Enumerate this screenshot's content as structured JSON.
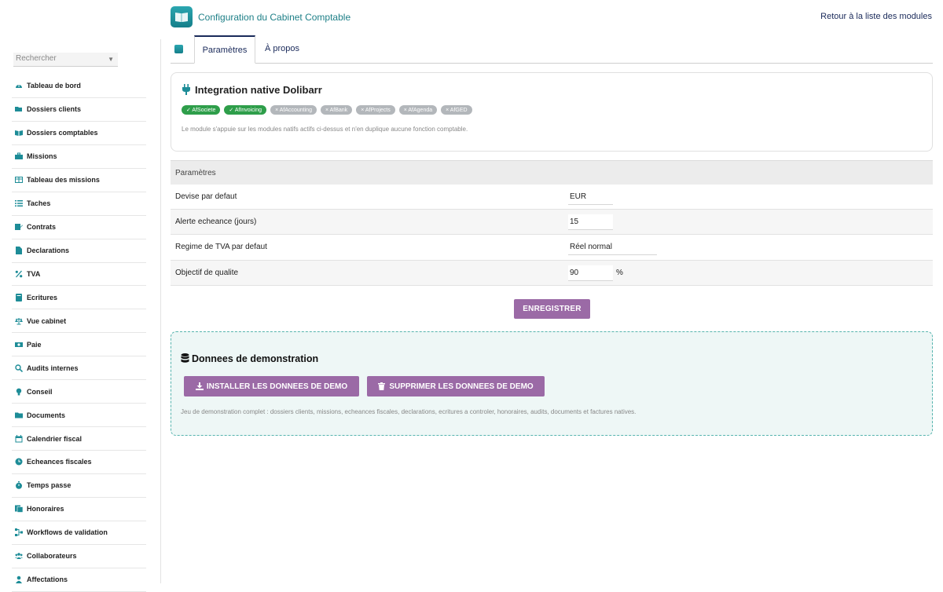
{
  "header": {
    "title": "Configuration du Cabinet Comptable",
    "back_link": "Retour à la liste des modules"
  },
  "sidebar": {
    "search_placeholder": "Rechercher",
    "items": [
      {
        "label": "Tableau de bord",
        "icon": "dashboard-icon"
      },
      {
        "label": "Dossiers clients",
        "icon": "folder-open-icon"
      },
      {
        "label": "Dossiers comptables",
        "icon": "book-icon"
      },
      {
        "label": "Missions",
        "icon": "briefcase-icon"
      },
      {
        "label": "Tableau des missions",
        "icon": "table-icon"
      },
      {
        "label": "Taches",
        "icon": "list-icon"
      },
      {
        "label": "Contrats",
        "icon": "contract-icon"
      },
      {
        "label": "Declarations",
        "icon": "file-icon"
      },
      {
        "label": "TVA",
        "icon": "percent-icon"
      },
      {
        "label": "Ecritures",
        "icon": "ledger-icon"
      },
      {
        "label": "Vue cabinet",
        "icon": "scale-icon"
      },
      {
        "label": "Paie",
        "icon": "money-icon"
      },
      {
        "label": "Audits internes",
        "icon": "search-icon"
      },
      {
        "label": "Conseil",
        "icon": "lightbulb-icon"
      },
      {
        "label": "Documents",
        "icon": "folder-icon"
      },
      {
        "label": "Calendrier fiscal",
        "icon": "calendar-icon"
      },
      {
        "label": "Echeances fiscales",
        "icon": "clock-icon"
      },
      {
        "label": "Temps passe",
        "icon": "stopwatch-icon"
      },
      {
        "label": "Honoraires",
        "icon": "invoice-icon"
      },
      {
        "label": "Workflows de validation",
        "icon": "workflow-icon"
      },
      {
        "label": "Collaborateurs",
        "icon": "users-icon"
      },
      {
        "label": "Affectations",
        "icon": "user-icon"
      }
    ]
  },
  "tabs": {
    "params": "Paramètres",
    "about": "À propos"
  },
  "integration": {
    "title": "Integration native Dolibarr",
    "badges": [
      {
        "label": "✓ AfSociete",
        "active": true
      },
      {
        "label": "✓ AfInvoicing",
        "active": true
      },
      {
        "label": "× AfAccounting",
        "active": false
      },
      {
        "label": "× AfBank",
        "active": false
      },
      {
        "label": "× AfProjects",
        "active": false
      },
      {
        "label": "× AfAgenda",
        "active": false
      },
      {
        "label": "× AfGED",
        "active": false
      }
    ],
    "note": "Le module s'appuie sur les modules natifs actifs ci-dessus et n'en duplique aucune fonction comptable."
  },
  "params": {
    "header": "Paramètres",
    "rows": [
      {
        "label": "Devise par defaut",
        "value": "EUR"
      },
      {
        "label": "Alerte echeance (jours)",
        "value": "15"
      },
      {
        "label": "Regime de TVA par defaut",
        "value": "Réel normal"
      },
      {
        "label": "Objectif de qualite",
        "value": "90",
        "unit": "%"
      }
    ],
    "save_label": "ENREGISTRER"
  },
  "demo": {
    "title": "Donnees de demonstration",
    "install_label": "INSTALLER LES DONNEES DE DEMO",
    "delete_label": "SUPPRIMER LES DONNEES DE DEMO",
    "note": "Jeu de demonstration complet : dossiers clients, missions, echeances fiscales, declarations, ecritures a controler, honoraires, audits, documents et factures natives."
  },
  "colors": {
    "accent": "#1d8c97",
    "button": "#9b6aa6",
    "badge_active": "#2e9e4a",
    "badge_inactive": "#b3b7bb",
    "link": "#1a2a5a"
  }
}
